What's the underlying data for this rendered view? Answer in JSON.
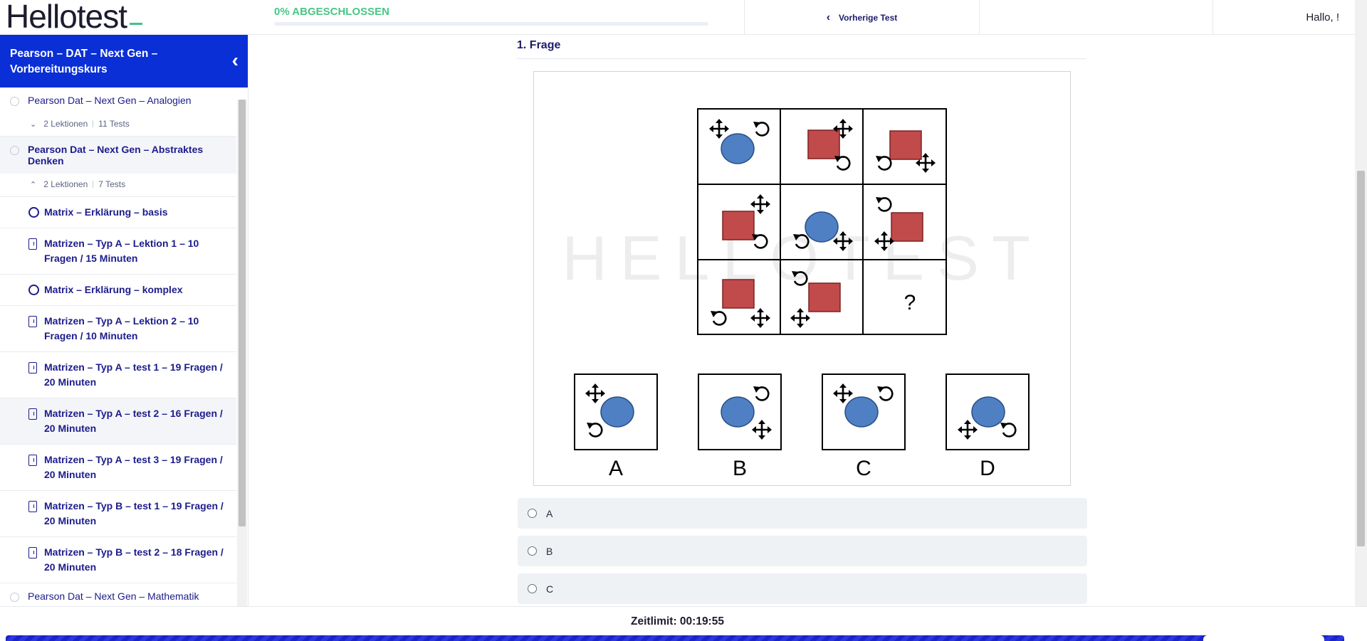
{
  "header": {
    "logo": "Hellotest",
    "progress_label": "0% ABGESCHLOSSEN",
    "progress_fraction": 0,
    "prev_label": "Vorherige Test",
    "greeting": "Hallo, !"
  },
  "sidebar": {
    "course_title": "Pearson – DAT – Next Gen – Vorbereitungskurs",
    "sections": [
      {
        "title": "Pearson Dat – Next Gen – Analogien",
        "lessons": "2 Lektionen",
        "tests": "11 Tests"
      },
      {
        "title": "Pearson Dat – Next Gen – Abstraktes Denken",
        "lessons": "2 Lektionen",
        "tests": "7 Tests"
      }
    ],
    "items": [
      {
        "label": "Matrix – Erklärung – basis",
        "icon": "circle-icon"
      },
      {
        "label": "Matrizen – Typ A – Lektion 1 – 10 Fragen / 15 Minuten",
        "icon": "document-icon"
      },
      {
        "label": "Matrix – Erklärung – komplex",
        "icon": "circle-icon"
      },
      {
        "label": "Matrizen – Typ A – Lektion 2 – 10 Fragen / 10 Minuten",
        "icon": "document-icon"
      },
      {
        "label": "Matrizen – Typ A – test 1 – 19 Fragen / 20 Minuten",
        "icon": "document-icon"
      },
      {
        "label": "Matrizen – Typ A – test 2 – 16 Fragen / 20 Minuten",
        "icon": "document-icon"
      },
      {
        "label": "Matrizen – Typ A – test 3 – 19 Fragen / 20 Minuten",
        "icon": "document-icon"
      },
      {
        "label": "Matrizen – Typ B – test 1 – 19 Fragen / 20 Minuten",
        "icon": "document-icon"
      },
      {
        "label": "Matrizen – Typ B – test 2 – 18 Fragen / 20 Minuten",
        "icon": "document-icon"
      }
    ],
    "next_section": "Pearson Dat – Next Gen – Mathematik"
  },
  "question": {
    "title": "1. Frage",
    "watermark": "HELLOTEST",
    "unknown_mark": "?",
    "figure_labels": [
      "A",
      "B",
      "C",
      "D"
    ],
    "options": [
      "A",
      "B",
      "C"
    ]
  },
  "footer": {
    "timer": "Zeitlimit: 00:19:55"
  },
  "colors": {
    "brand_blue": "#0a2fd6",
    "progress_green": "#47c785",
    "circle_fill": "#4f80c4",
    "square_fill": "#c14a4a"
  }
}
